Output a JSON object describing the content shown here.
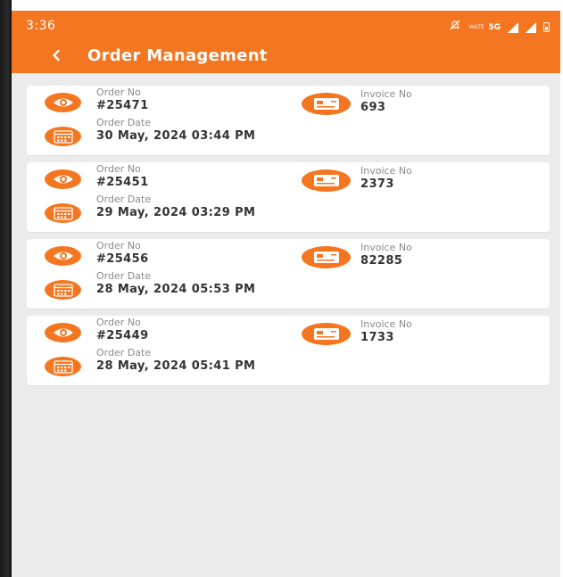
{
  "status_bar": {
    "time": "3:36",
    "icons": [
      "mute-icon",
      "volte-icon",
      "5g-icon",
      "signal-icon",
      "signal-icon",
      "battery-icon"
    ],
    "network_label": "5G",
    "volte_label": "VoLTE"
  },
  "app_bar": {
    "title": "Order Management",
    "back_icon": "chevron-left-icon"
  },
  "labels": {
    "order_no": "Order No",
    "invoice_no": "Invoice No",
    "order_date": "Order Date"
  },
  "orders": [
    {
      "order_no": "#25471",
      "invoice_no": "693",
      "order_date": "30 May, 2024 03:44 PM"
    },
    {
      "order_no": "#25451",
      "invoice_no": "2373",
      "order_date": "29 May, 2024 03:29 PM"
    },
    {
      "order_no": "#25456",
      "invoice_no": "82285",
      "order_date": "28 May, 2024 05:53 PM"
    },
    {
      "order_no": "#25449",
      "invoice_no": "1733",
      "order_date": "28 May, 2024 05:41 PM"
    }
  ],
  "colors": {
    "accent": "#f47620",
    "background": "#ebebeb",
    "card": "#ffffff",
    "label_text": "#8a8a8a",
    "value_text": "#333333"
  }
}
